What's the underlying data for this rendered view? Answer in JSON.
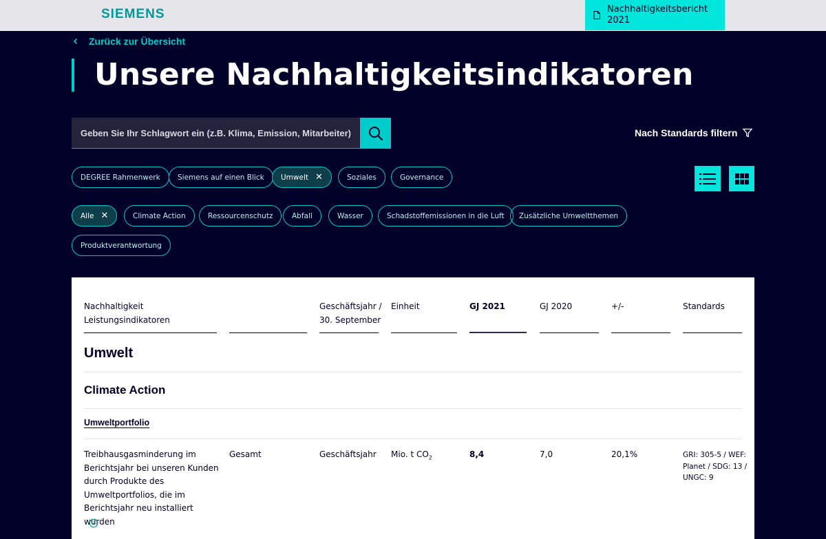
{
  "header": {
    "logo": "SIEMENS",
    "report_button": "Nachhaltigkeitsbericht 2021",
    "report_icon": "document-icon"
  },
  "back_link": "Zurück zur Übersicht",
  "page_title": "Unsere Nachhaltigkeitsindikatoren",
  "search": {
    "placeholder": "Geben Sie Ihr Schlagwort ein (z.B. Klima, Emission, Mitarbeiter)",
    "value": ""
  },
  "filter_standards": "Nach Standards filtern",
  "category_chips": [
    {
      "label": "DEGREE Rahmenwerk",
      "active": false
    },
    {
      "label": "Siemens auf einen Blick",
      "active": false
    },
    {
      "label": "Umwelt",
      "active": true
    },
    {
      "label": "Soziales",
      "active": false
    },
    {
      "label": "Governance",
      "active": false
    }
  ],
  "topic_chips": [
    {
      "label": "Alle",
      "active": true
    },
    {
      "label": "Climate Action",
      "active": false
    },
    {
      "label": "Ressourcenschutz",
      "active": false
    },
    {
      "label": "Abfall",
      "active": false
    },
    {
      "label": "Wasser",
      "active": false
    },
    {
      "label": "Schadstoffemissionen in die Luft",
      "active": false
    },
    {
      "label": "Zusätzliche Umweltthemen",
      "active": false
    },
    {
      "label": "Produktverantwortung",
      "active": false
    }
  ],
  "view_toggle": {
    "list": "list-view-icon",
    "grid": "grid-view-icon",
    "selected": "list"
  },
  "colors": {
    "background": "#000028",
    "accent": "#00cccc",
    "accent_bright": "#00e6dc",
    "logo": "#009999"
  },
  "table": {
    "headers": {
      "indicator_1": "Nachhaltigkeit",
      "indicator_2": "Leistungsindikatoren",
      "fy_1": "Geschäftsjahr /",
      "fy_2": "30. September",
      "unit": "Einheit",
      "gj2021": "GJ 2021",
      "gj2020": "GJ 2020",
      "change": "+/-",
      "standards": "Standards"
    },
    "section": "Umwelt",
    "subsection": "Climate Action",
    "group": "Umweltportfolio",
    "rows": [
      {
        "indicator_lines": [
          "Treibhausgasminderung im",
          "Berichtsjahr bei unseren Kunden",
          "durch Produkte des",
          "Umweltportfolios, die im",
          "Berichtsjahr neu installiert wurden"
        ],
        "scope": "Gesamt",
        "period": "Geschäftsjahr",
        "unit": "Mio. t CO",
        "unit_sub": "2",
        "gj2021": "8,4",
        "gj2020": "7,0",
        "change": "20,1%",
        "standards_lines": [
          "GRI: 305-5 / WEF:",
          "Planet / SDG: 13 /",
          "UNGC: 9"
        ]
      }
    ]
  }
}
